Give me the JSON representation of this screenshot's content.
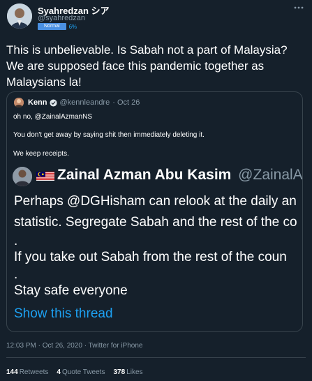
{
  "author": {
    "display_name": "Syahredzan シア",
    "handle": "@syahredzan",
    "badge": "Normal",
    "badge_percent": "6%"
  },
  "tweet": {
    "lines": [
      "This is unbelievable. Is Sabah not a part of Malaysia?",
      "We are supposed face this pandemic together as",
      "Malaysians la!"
    ]
  },
  "quote": {
    "name": "Kenn",
    "handle": "@kennleandre",
    "date": "· Oct 26",
    "lines": [
      "oh no, @ZainalAzmanNS",
      "You don't get away by saying shit then immediately deleting it.",
      "We keep receipts."
    ],
    "screenshot": {
      "name": "Zainal Azman Abu Kasim",
      "handle": "@ZainalAzma",
      "lines": [
        "Perhaps @DGHisham can relook at the daily an",
        "statistic. Segregate Sabah and the rest of the co",
        ".",
        "If you take out Sabah from the rest of the coun",
        ".",
        "Stay safe everyone"
      ],
      "link": "Show this thread"
    }
  },
  "meta": {
    "timestamp": "12:03 PM · Oct 26, 2020 · Twitter for iPhone"
  },
  "stats": [
    {
      "count": "144",
      "label": "Retweets"
    },
    {
      "count": "4",
      "label": "Quote Tweets"
    },
    {
      "count": "378",
      "label": "Likes"
    }
  ],
  "colors": {
    "background": "#15202b",
    "accent": "#1da1f2",
    "muted": "#8899a6",
    "border": "#38444d",
    "badge": "#4a90e2"
  },
  "icons": [
    "more-icon",
    "verified-icon",
    "malaysia-flag-icon"
  ]
}
